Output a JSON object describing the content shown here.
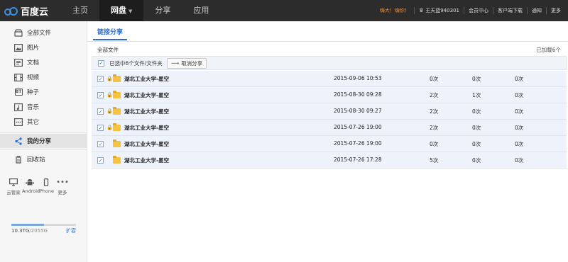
{
  "brand": {
    "name": "百度云"
  },
  "nav": [
    {
      "label": "主页",
      "active": false
    },
    {
      "label": "网盘",
      "active": true
    },
    {
      "label": "分享",
      "active": false
    },
    {
      "label": "应用",
      "active": false
    }
  ],
  "topright": {
    "promo": "嗨大！嗨你！",
    "username": "王天蓝940301",
    "vip": "会员中心",
    "client": "客户端下载",
    "notify": "通知",
    "more": "更多"
  },
  "sidebar": {
    "items": [
      {
        "label": "全部文件",
        "icon": "file-icon"
      },
      {
        "label": "图片",
        "icon": "picture-icon"
      },
      {
        "label": "文档",
        "icon": "document-icon"
      },
      {
        "label": "视频",
        "icon": "video-icon"
      },
      {
        "label": "种子",
        "icon": "bt-icon"
      },
      {
        "label": "音乐",
        "icon": "music-icon"
      },
      {
        "label": "其它",
        "icon": "other-icon"
      }
    ],
    "share": "我的分享",
    "recycle": "回收站",
    "devices": [
      "云管家",
      "Android",
      "iPhone",
      "更多"
    ],
    "quota_used": "10.3TG",
    "quota_total": "/2055G",
    "quota_fraction": 0.5,
    "expand": "扩容"
  },
  "main": {
    "tab": "链接分享",
    "path": "全部文件",
    "loaded": "已加载6个",
    "selection_text": "已选中6个文件/文件夹",
    "unshare_label": "取消分享",
    "rows": [
      {
        "name": "湖北工业大学-星空",
        "date": "2015-09-06 10:53",
        "c1": "0次",
        "c2": "0次",
        "c3": "0次",
        "locked": true
      },
      {
        "name": "湖北工业大学-星空",
        "date": "2015-08-30 09:28",
        "c1": "2次",
        "c2": "1次",
        "c3": "0次",
        "locked": true
      },
      {
        "name": "湖北工业大学-星空",
        "date": "2015-08-30 09:27",
        "c1": "2次",
        "c2": "0次",
        "c3": "0次",
        "locked": true
      },
      {
        "name": "湖北工业大学-星空",
        "date": "2015-07-26 19:00",
        "c1": "2次",
        "c2": "0次",
        "c3": "0次",
        "locked": true
      },
      {
        "name": "湖北工业大学-星空",
        "date": "2015-07-26 19:00",
        "c1": "0次",
        "c2": "0次",
        "c3": "0次",
        "locked": false
      },
      {
        "name": "湖北工业大学-星空",
        "date": "2015-07-26 17:28",
        "c1": "5次",
        "c2": "0次",
        "c3": "0次",
        "locked": false
      }
    ]
  },
  "colors": {
    "topbar": "#2c2c2c",
    "accent": "#2a6cd6",
    "row_selected": "#eef3fb",
    "promo": "#f08a2c"
  }
}
